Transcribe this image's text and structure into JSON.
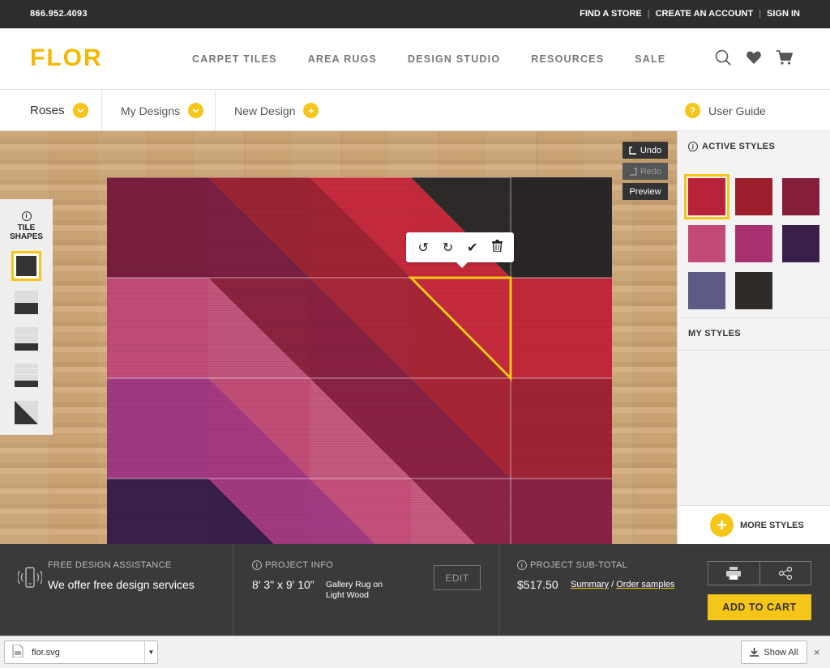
{
  "topbar": {
    "phone": "866.952.4093",
    "links": [
      "FIND A STORE",
      "CREATE AN ACCOUNT",
      "SIGN IN"
    ],
    "separator": "|"
  },
  "header": {
    "logo": "FLOR",
    "nav": [
      "CARPET TILES",
      "AREA RUGS",
      "DESIGN STUDIO",
      "RESOURCES",
      "SALE"
    ],
    "icons": [
      "search-icon",
      "heart-icon",
      "cart-icon"
    ]
  },
  "subnav": {
    "current_design": "Roses",
    "my_designs": "My Designs",
    "new_design": "New Design",
    "user_guide": "User Guide",
    "help_mark": "?",
    "plus_mark": "+"
  },
  "tools": {
    "undo": "Undo",
    "redo": "Redo",
    "preview": "Preview"
  },
  "tile_shapes": {
    "title_line1": "TILE",
    "title_line2": "SHAPES",
    "info_mark": "i"
  },
  "popover": {
    "rotate_left": "↺",
    "rotate_right": "↻",
    "confirm": "✔",
    "delete": "🗑"
  },
  "styles_panel": {
    "active_styles": "ACTIVE STYLES",
    "my_styles": "MY STYLES",
    "more_styles": "MORE STYLES",
    "swatch_colors": [
      "#b8233a",
      "#9a1f2a",
      "#86203a",
      "#c24a78",
      "#a8326f",
      "#3a1f4a",
      "#5e5a86",
      "#2e2a28"
    ]
  },
  "bottom": {
    "assistance_label": "FREE DESIGN ASSISTANCE",
    "assistance_text": "We offer free design services",
    "project_info_label": "PROJECT INFO",
    "dimensions": "8' 3\" x 9' 10\"",
    "rug_type_line1": "Gallery Rug  on",
    "rug_type_line2": "Light Wood",
    "edit": "EDIT",
    "subtotal_label": "PROJECT SUB-TOTAL",
    "subtotal": "$517.50",
    "summary_link": "Summary",
    "link_sep": "/",
    "samples_link": "Order samples",
    "add_to_cart": "ADD TO CART"
  },
  "download_bar": {
    "filename": "flor.svg",
    "show_all": "Show All",
    "close": "×"
  },
  "colors": {
    "accent": "#f5c518",
    "dark": "#2d2d2d"
  }
}
